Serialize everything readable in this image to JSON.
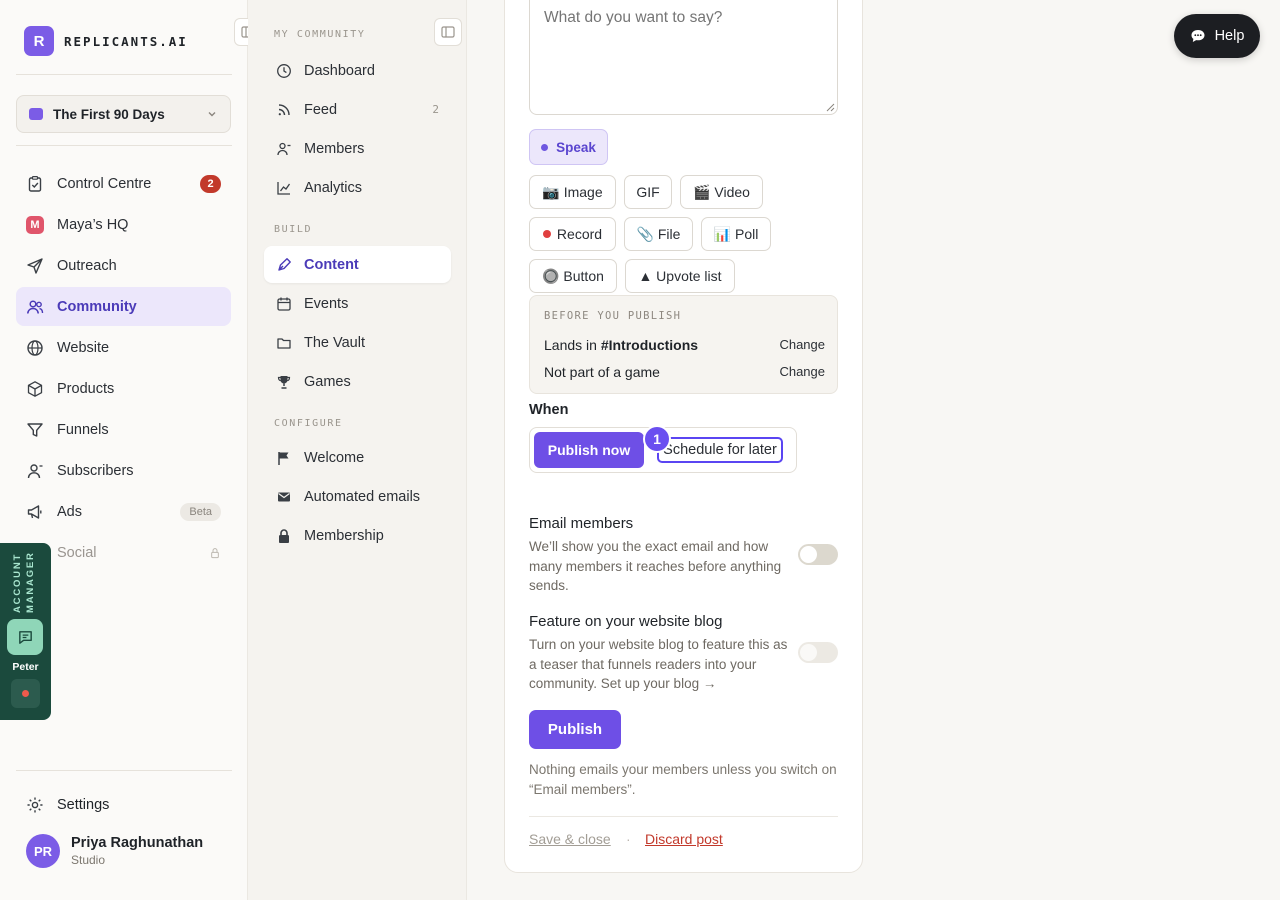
{
  "brand": {
    "mark": "R",
    "name": "REPLICANTS.AI"
  },
  "workspace": {
    "name": "The First 90 Days"
  },
  "sidebar": {
    "items": [
      {
        "label": "Control Centre",
        "icon": "clipboard-check-icon",
        "badge": "2"
      },
      {
        "label": "Maya’s HQ",
        "icon": "maya-avatar-icon",
        "mark": "M"
      },
      {
        "label": "Outreach",
        "icon": "send-icon"
      },
      {
        "label": "Community",
        "icon": "users-icon",
        "active": true
      },
      {
        "label": "Website",
        "icon": "globe-icon"
      },
      {
        "label": "Products",
        "icon": "box-icon"
      },
      {
        "label": "Funnels",
        "icon": "funnel-icon"
      },
      {
        "label": "Subscribers",
        "icon": "subscribers-icon"
      },
      {
        "label": "Ads",
        "icon": "megaphone-icon",
        "badge": "Beta"
      },
      {
        "label": "Social",
        "icon": "social-icon",
        "locked": true
      }
    ],
    "settings": "Settings",
    "profile": {
      "initials": "PR",
      "name": "Priya Raghunathan",
      "plan": "Studio"
    }
  },
  "account_manager": {
    "label": "ACCOUNT MANAGER",
    "name": "Peter"
  },
  "subnav": {
    "my_community_title": "MY COMMUNITY",
    "my_community": [
      {
        "label": "Dashboard",
        "icon": "clock-icon"
      },
      {
        "label": "Feed",
        "icon": "rss-icon",
        "count": "2"
      },
      {
        "label": "Members",
        "icon": "member-icon"
      },
      {
        "label": "Analytics",
        "icon": "chart-icon"
      }
    ],
    "build_title": "BUILD",
    "build": [
      {
        "label": "Content",
        "icon": "pen-nib-icon",
        "active": true
      },
      {
        "label": "Events",
        "icon": "calendar-icon"
      },
      {
        "label": "The Vault",
        "icon": "folder-icon"
      },
      {
        "label": "Games",
        "icon": "trophy-icon"
      }
    ],
    "configure_title": "CONFIGURE",
    "configure": [
      {
        "label": "Welcome",
        "icon": "flag-icon"
      },
      {
        "label": "Automated emails",
        "icon": "envelope-icon"
      },
      {
        "label": "Membership",
        "icon": "lock-icon"
      }
    ]
  },
  "composer": {
    "placeholder": "What do you want to say?",
    "speak": "Speak",
    "attachments": {
      "image": "📷 Image",
      "gif": "GIF",
      "video": "🎬 Video",
      "record": "Record",
      "file": "📎 File",
      "poll": "📊 Poll",
      "button": "🔘 Button",
      "upvote": "▲ Upvote list"
    },
    "before_publish": {
      "title": "BEFORE YOU PUBLISH",
      "lands_prefix": "Lands in ",
      "channel": "#Introductions",
      "game_status": "Not part of a game",
      "change": "Change"
    },
    "when": {
      "label": "When",
      "publish_now": "Publish now",
      "schedule_later": "Schedule for later",
      "step": "1",
      "selected": "Publish now"
    },
    "email_members": {
      "title": "Email members",
      "desc": "We’ll show you the exact email and how many members it reaches before anything sends.",
      "enabled": false
    },
    "feature_blog": {
      "title": "Feature on your website blog",
      "desc": "Turn on your website blog to feature this as a teaser that funnels readers into your community. Set up your blog →",
      "enabled": false,
      "disabled": true
    },
    "publish": "Publish",
    "note": "Nothing emails your members unless you switch on “Email members”.",
    "save_close": "Save & close",
    "separator": "·",
    "discard": "Discard post"
  },
  "help": {
    "label": "Help"
  },
  "colors": {
    "accent": "#6e4fe6",
    "danger": "#c2392b",
    "account_manager_bg": "#1b4a3d"
  }
}
